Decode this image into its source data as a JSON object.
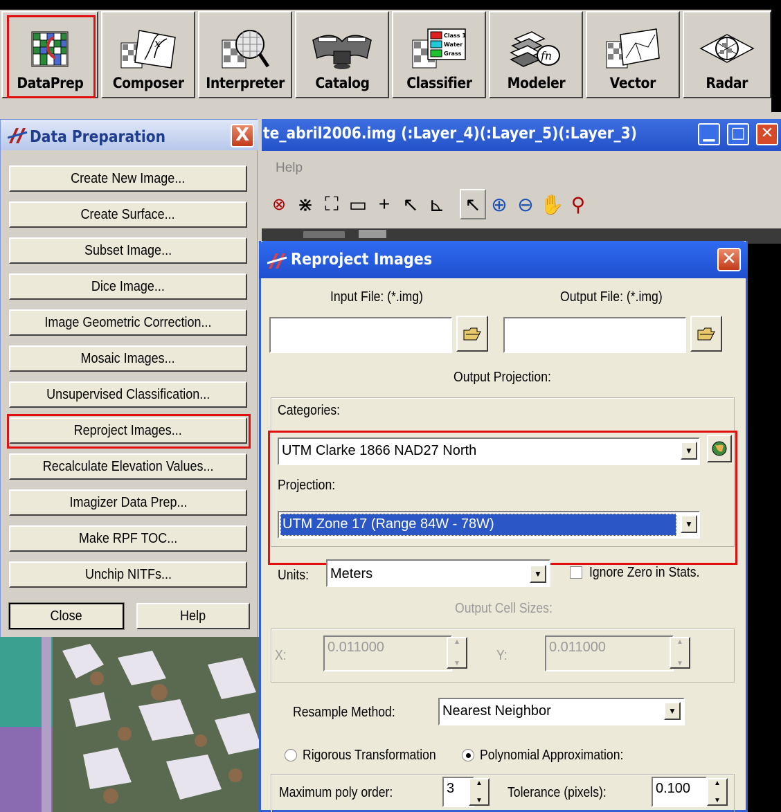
{
  "toolbar": {
    "buttons": [
      {
        "label": "DataPrep",
        "icon": "dataprep-grid-icon"
      },
      {
        "label": "Composer",
        "icon": "composer-icon"
      },
      {
        "label": "Interpreter",
        "icon": "magnifier-grid-icon"
      },
      {
        "label": "Catalog",
        "icon": "catalog-book-icon"
      },
      {
        "label": "Classifier",
        "icon": "classifier-legend-icon"
      },
      {
        "label": "Modeler",
        "icon": "modeler-stack-icon"
      },
      {
        "label": "Vector",
        "icon": "vector-map-icon"
      },
      {
        "label": "Radar",
        "icon": "radar-icon"
      }
    ],
    "classifier_legend": [
      "Class 1",
      "Water",
      "Grass"
    ],
    "highlight_color": "#e01010"
  },
  "data_prep": {
    "title": "Data Preparation",
    "close_glyph": "X",
    "items": [
      "Create New Image...",
      "Create Surface...",
      "Subset Image...",
      "Dice Image...",
      "Image Geometric Correction...",
      "Mosaic Images...",
      "Unsupervised Classification...",
      "Reproject Images...",
      "Recalculate Elevation Values...",
      "Imagizer Data Prep...",
      "Make RPF TOC...",
      "Unchip NITFs..."
    ],
    "highlighted_item": "Reproject Images...",
    "close_label": "Close",
    "help_label": "Help"
  },
  "image_window": {
    "title": "te_abril2006.img (:Layer_4)(:Layer_5)(:Layer_3)",
    "menu_help": "Help",
    "tools": [
      "inquire-icon",
      "zoom-in-fixed-icon",
      "zoom-out-fixed-icon",
      "measure-icon",
      "crosshair-icon",
      "select-pointer-icon",
      "profile-icon",
      "arrow-pointer-icon",
      "zoom-in-icon",
      "zoom-out-icon",
      "pan-hand-icon",
      "rotate-icon"
    ]
  },
  "reproject": {
    "title": "Reproject Images",
    "input_label": "Input File: (*.img)",
    "output_label": "Output File: (*.img)",
    "input_value": "",
    "output_value": "",
    "output_projection_label": "Output Projection:",
    "categories_label": "Categories:",
    "categories_value": "UTM Clarke 1866 NAD27 North",
    "projection_label": "Projection:",
    "projection_value": "UTM Zone 17  (Range 84W - 78W)",
    "units_label": "Units:",
    "units_value": "Meters",
    "ignore_zero_label": "Ignore Zero in Stats.",
    "cell_sizes_label": "Output Cell Sizes:",
    "x_label": "X:",
    "x_value": "0.011000",
    "y_label": "Y:",
    "y_value": "0.011000",
    "resample_label": "Resample Method:",
    "resample_value": "Nearest Neighbor",
    "rigorous_label": "Rigorous Transformation",
    "polynomial_label": "Polynomial Approximation:",
    "selected_method": "Polynomial Approximation:",
    "max_poly_label": "Maximum poly order:",
    "max_poly_value": "3",
    "tolerance_label": "Tolerance (pixels):",
    "tolerance_value": "0.100"
  }
}
